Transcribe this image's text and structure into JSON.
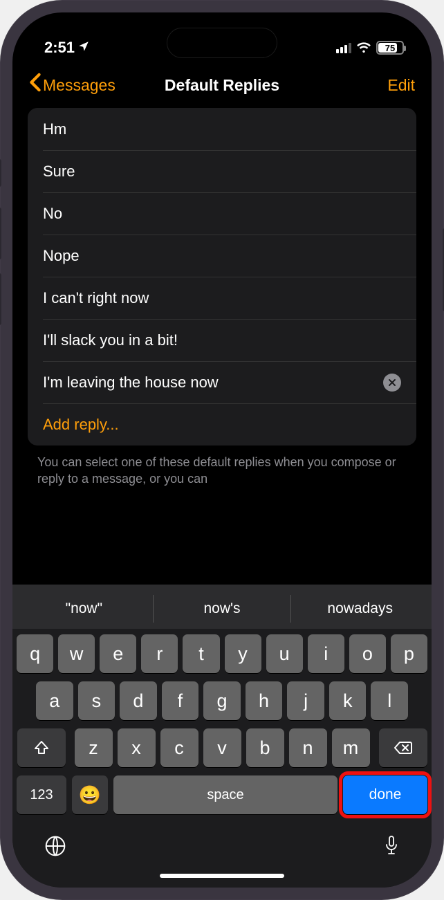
{
  "status": {
    "time": "2:51",
    "location_arrow": "➤",
    "battery_pct": "75"
  },
  "nav": {
    "back_label": "Messages",
    "title": "Default Replies",
    "edit_label": "Edit"
  },
  "replies": {
    "items": [
      "Hm",
      "Sure",
      "No",
      "Nope",
      "I can't right now",
      "I'll slack you in a bit!"
    ],
    "editing_value": "I'm leaving the house now",
    "add_label": "Add reply...",
    "hint": "You can select one of these default replies when you compose or reply to a message, or you can"
  },
  "keyboard": {
    "predictions": [
      "\"now\"",
      "now's",
      "nowadays"
    ],
    "row1": [
      "q",
      "w",
      "e",
      "r",
      "t",
      "y",
      "u",
      "i",
      "o",
      "p"
    ],
    "row2": [
      "a",
      "s",
      "d",
      "f",
      "g",
      "h",
      "j",
      "k",
      "l"
    ],
    "row3": [
      "z",
      "x",
      "c",
      "v",
      "b",
      "n",
      "m"
    ],
    "key_123": "123",
    "key_space": "space",
    "key_done": "done"
  }
}
